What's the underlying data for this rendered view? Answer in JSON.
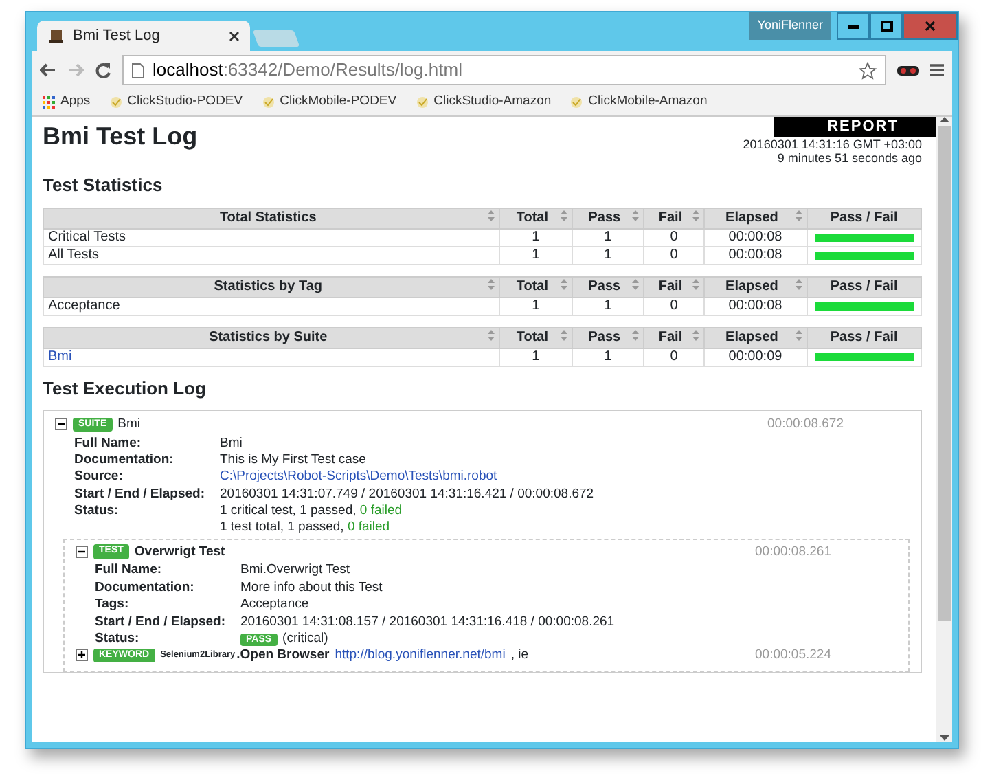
{
  "browser": {
    "user": "YoniFlenner",
    "tabs": [
      {
        "title": "Bmi Test Log",
        "selected": true
      }
    ],
    "address": {
      "host": "localhost",
      "rest": ":63342/Demo/Results/log.html"
    },
    "bookmarks": [
      {
        "label": "Apps",
        "kind": "apps"
      },
      {
        "label": "ClickStudio-PODEV",
        "kind": "page"
      },
      {
        "label": "ClickMobile-PODEV",
        "kind": "page"
      },
      {
        "label": "ClickStudio-Amazon",
        "kind": "page"
      },
      {
        "label": "ClickMobile-Amazon",
        "kind": "page"
      }
    ]
  },
  "page": {
    "title": "Bmi Test Log",
    "report_link": "REPORT",
    "generated": "20160301 14:31:16 GMT +03:00",
    "ago": "9 minutes 51 seconds ago",
    "stats_title": "Test Statistics",
    "stats": [
      {
        "columns": [
          "Total Statistics",
          "Total",
          "Pass",
          "Fail",
          "Elapsed",
          "Pass / Fail"
        ],
        "rows": [
          {
            "name": "Critical Tests",
            "kind": "text",
            "total": "1",
            "pass": "1",
            "fail": "0",
            "elapsed": "00:00:08",
            "level": 1
          },
          {
            "name": "All Tests",
            "kind": "text",
            "total": "1",
            "pass": "1",
            "fail": "0",
            "elapsed": "00:00:08",
            "level": 1
          }
        ]
      },
      {
        "columns": [
          "Statistics by Tag",
          "Total",
          "Pass",
          "Fail",
          "Elapsed",
          "Pass / Fail"
        ],
        "rows": [
          {
            "name": "Acceptance",
            "kind": "text",
            "total": "1",
            "pass": "1",
            "fail": "0",
            "elapsed": "00:00:08",
            "level": 1
          }
        ]
      },
      {
        "columns": [
          "Statistics by Suite",
          "Total",
          "Pass",
          "Fail",
          "Elapsed",
          "Pass / Fail"
        ],
        "rows": [
          {
            "name": "Bmi",
            "kind": "link",
            "total": "1",
            "pass": "1",
            "fail": "0",
            "elapsed": "00:00:09",
            "level": 1
          }
        ]
      }
    ],
    "log_title": "Test Execution Log",
    "suite": {
      "badge": "SUITE",
      "name": "Bmi",
      "elapsed": "00:00:08.672",
      "expanded": true,
      "meta": [
        {
          "label": "Full Name:",
          "kind": "text",
          "value": "Bmi"
        },
        {
          "label": "Documentation:",
          "kind": "text",
          "value": "This is My First Test case"
        },
        {
          "label": "Source:",
          "kind": "link",
          "value": "C:\\Projects\\Robot-Scripts\\Demo\\Tests\\bmi.robot"
        },
        {
          "label": "Start / End / Elapsed:",
          "kind": "text",
          "value": "20160301 14:31:07.749 / 20160301 14:31:16.421 / 00:00:08.672"
        },
        {
          "label": "Status:",
          "kind": "status",
          "lines": [
            {
              "text": "1 critical test, 1 passed, ",
              "failed": "0 failed"
            },
            {
              "text": "1 test total, 1 passed, ",
              "failed": "0 failed"
            }
          ]
        }
      ],
      "test": {
        "badge": "TEST",
        "name": "Overwrigt Test",
        "elapsed": "00:00:08.261",
        "expanded": true,
        "meta": [
          {
            "label": "Full Name:",
            "kind": "text",
            "value": "Bmi.Overwrigt Test"
          },
          {
            "label": "Documentation:",
            "kind": "text",
            "value": "More info about this Test"
          },
          {
            "label": "Tags:",
            "kind": "text",
            "value": "Acceptance"
          },
          {
            "label": "Start / End / Elapsed:",
            "kind": "text",
            "value": "20160301 14:31:08.157 / 20160301 14:31:16.418 / 00:00:08.261"
          },
          {
            "label": "Status:",
            "kind": "pass",
            "badge": "PASS",
            "value": "(critical)"
          }
        ],
        "keyword": {
          "badge": "KEYWORD",
          "library": "Selenium2Library",
          "name": ".Open Browser",
          "arg_link": "http://blog.yoniflenner.net/bmi",
          "arg_rest": ", ie",
          "elapsed": "00:00:05.224",
          "expanded": false
        }
      }
    }
  }
}
